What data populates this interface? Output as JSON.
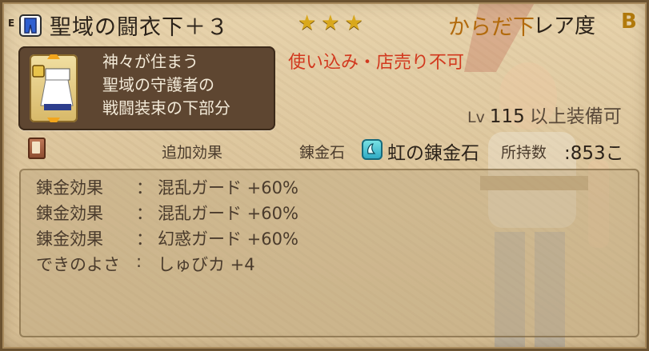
{
  "item": {
    "equip_marker": "E",
    "name": "聖域の闘衣下＋３",
    "stars": "★★★",
    "category": "からだ下",
    "rarity_label": "レア度",
    "rarity_value": "B",
    "description": [
      "神々が住まう",
      "聖域の守護者の",
      "戦闘装束の下部分"
    ],
    "restriction": "使い込み・店売り不可",
    "level_prefix": "Lv",
    "level_value": "115",
    "level_suffix": "以上装備可"
  },
  "section": {
    "additional_effects": "追加効果",
    "alchemy_stone_label": "錬金石",
    "alchemy_stone_name": "虹の錬金石",
    "owned_label": "所持数",
    "owned_value": ":853こ"
  },
  "effects": [
    {
      "label": "錬金効果",
      "colon": "：",
      "value": "混乱ガード +60%"
    },
    {
      "label": "錬金効果",
      "colon": "：",
      "value": "混乱ガード +60%"
    },
    {
      "label": "錬金効果",
      "colon": "：",
      "value": "幻惑ガード +60%"
    },
    {
      "label": "できのよさ",
      "colon": ":",
      "value": "しゅびカ +4"
    }
  ],
  "colors": {
    "category": "#b26a0c",
    "restriction": "#d2381e",
    "stars": "#d9a81c",
    "description_box": "#5e4631"
  },
  "icons": {
    "slot": "leg-armor-icon",
    "item": "robe-item-icon",
    "lock": "lock-icon",
    "book": "book-icon",
    "alchemy": "alchemy-stone-icon"
  }
}
